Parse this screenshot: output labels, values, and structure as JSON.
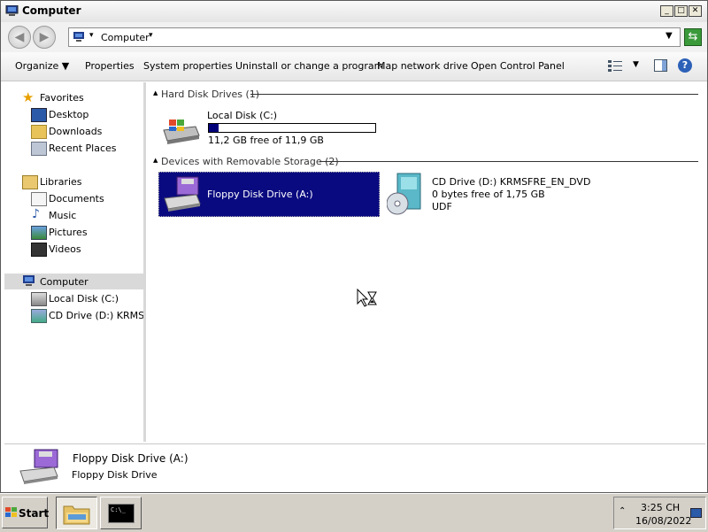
{
  "window": {
    "title": "Computer"
  },
  "address": {
    "path": "Computer"
  },
  "toolbar": {
    "organize": "Organize",
    "properties": "Properties",
    "system_properties": "System properties",
    "uninstall": "Uninstall or change a program",
    "map_network": "Map network drive",
    "open_control_panel": "Open Control Panel"
  },
  "nav": {
    "favorites": "Favorites",
    "desktop": "Desktop",
    "downloads": "Downloads",
    "recent_places": "Recent Places",
    "libraries": "Libraries",
    "documents": "Documents",
    "music": "Music",
    "pictures": "Pictures",
    "videos": "Videos",
    "computer": "Computer",
    "local_disk": "Local Disk (C:)",
    "cd_drive": "CD Drive (D:) KRMSFR"
  },
  "groups": {
    "hdd_header": "Hard Disk Drives (1)",
    "removable_header": "Devices with Removable Storage (2)"
  },
  "drives": {
    "c_name": "Local Disk (C:)",
    "c_free": "11,2 GB free of 11,9 GB",
    "c_used_fraction": 0.06,
    "a_name": "Floppy Disk Drive (A:)",
    "d_name": "CD Drive (D:) KRMSFRE_EN_DVD",
    "d_free": "0 bytes free of 1,75 GB",
    "d_fs": "UDF"
  },
  "details": {
    "name": "Floppy Disk Drive (A:)",
    "type": "Floppy Disk Drive"
  },
  "taskbar": {
    "start": "Start",
    "time": "3:25 CH",
    "date": "16/08/2022"
  }
}
